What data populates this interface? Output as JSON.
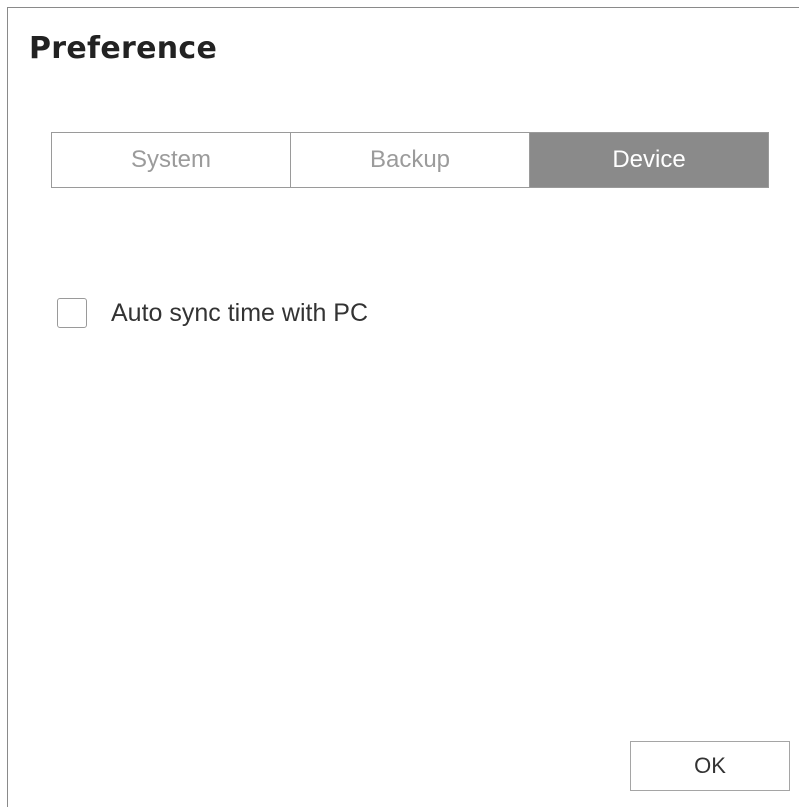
{
  "dialog": {
    "title": "Preference"
  },
  "tabs": [
    {
      "label": "System",
      "active": false
    },
    {
      "label": "Backup",
      "active": false
    },
    {
      "label": "Device",
      "active": true
    }
  ],
  "options": {
    "auto_sync": {
      "label": "Auto sync time with PC",
      "checked": false
    }
  },
  "footer": {
    "ok_label": "OK"
  },
  "colors": {
    "active_tab_bg": "#8a8a8a",
    "inactive_tab_text": "#9b9b9b",
    "border": "#9a9a9a"
  }
}
